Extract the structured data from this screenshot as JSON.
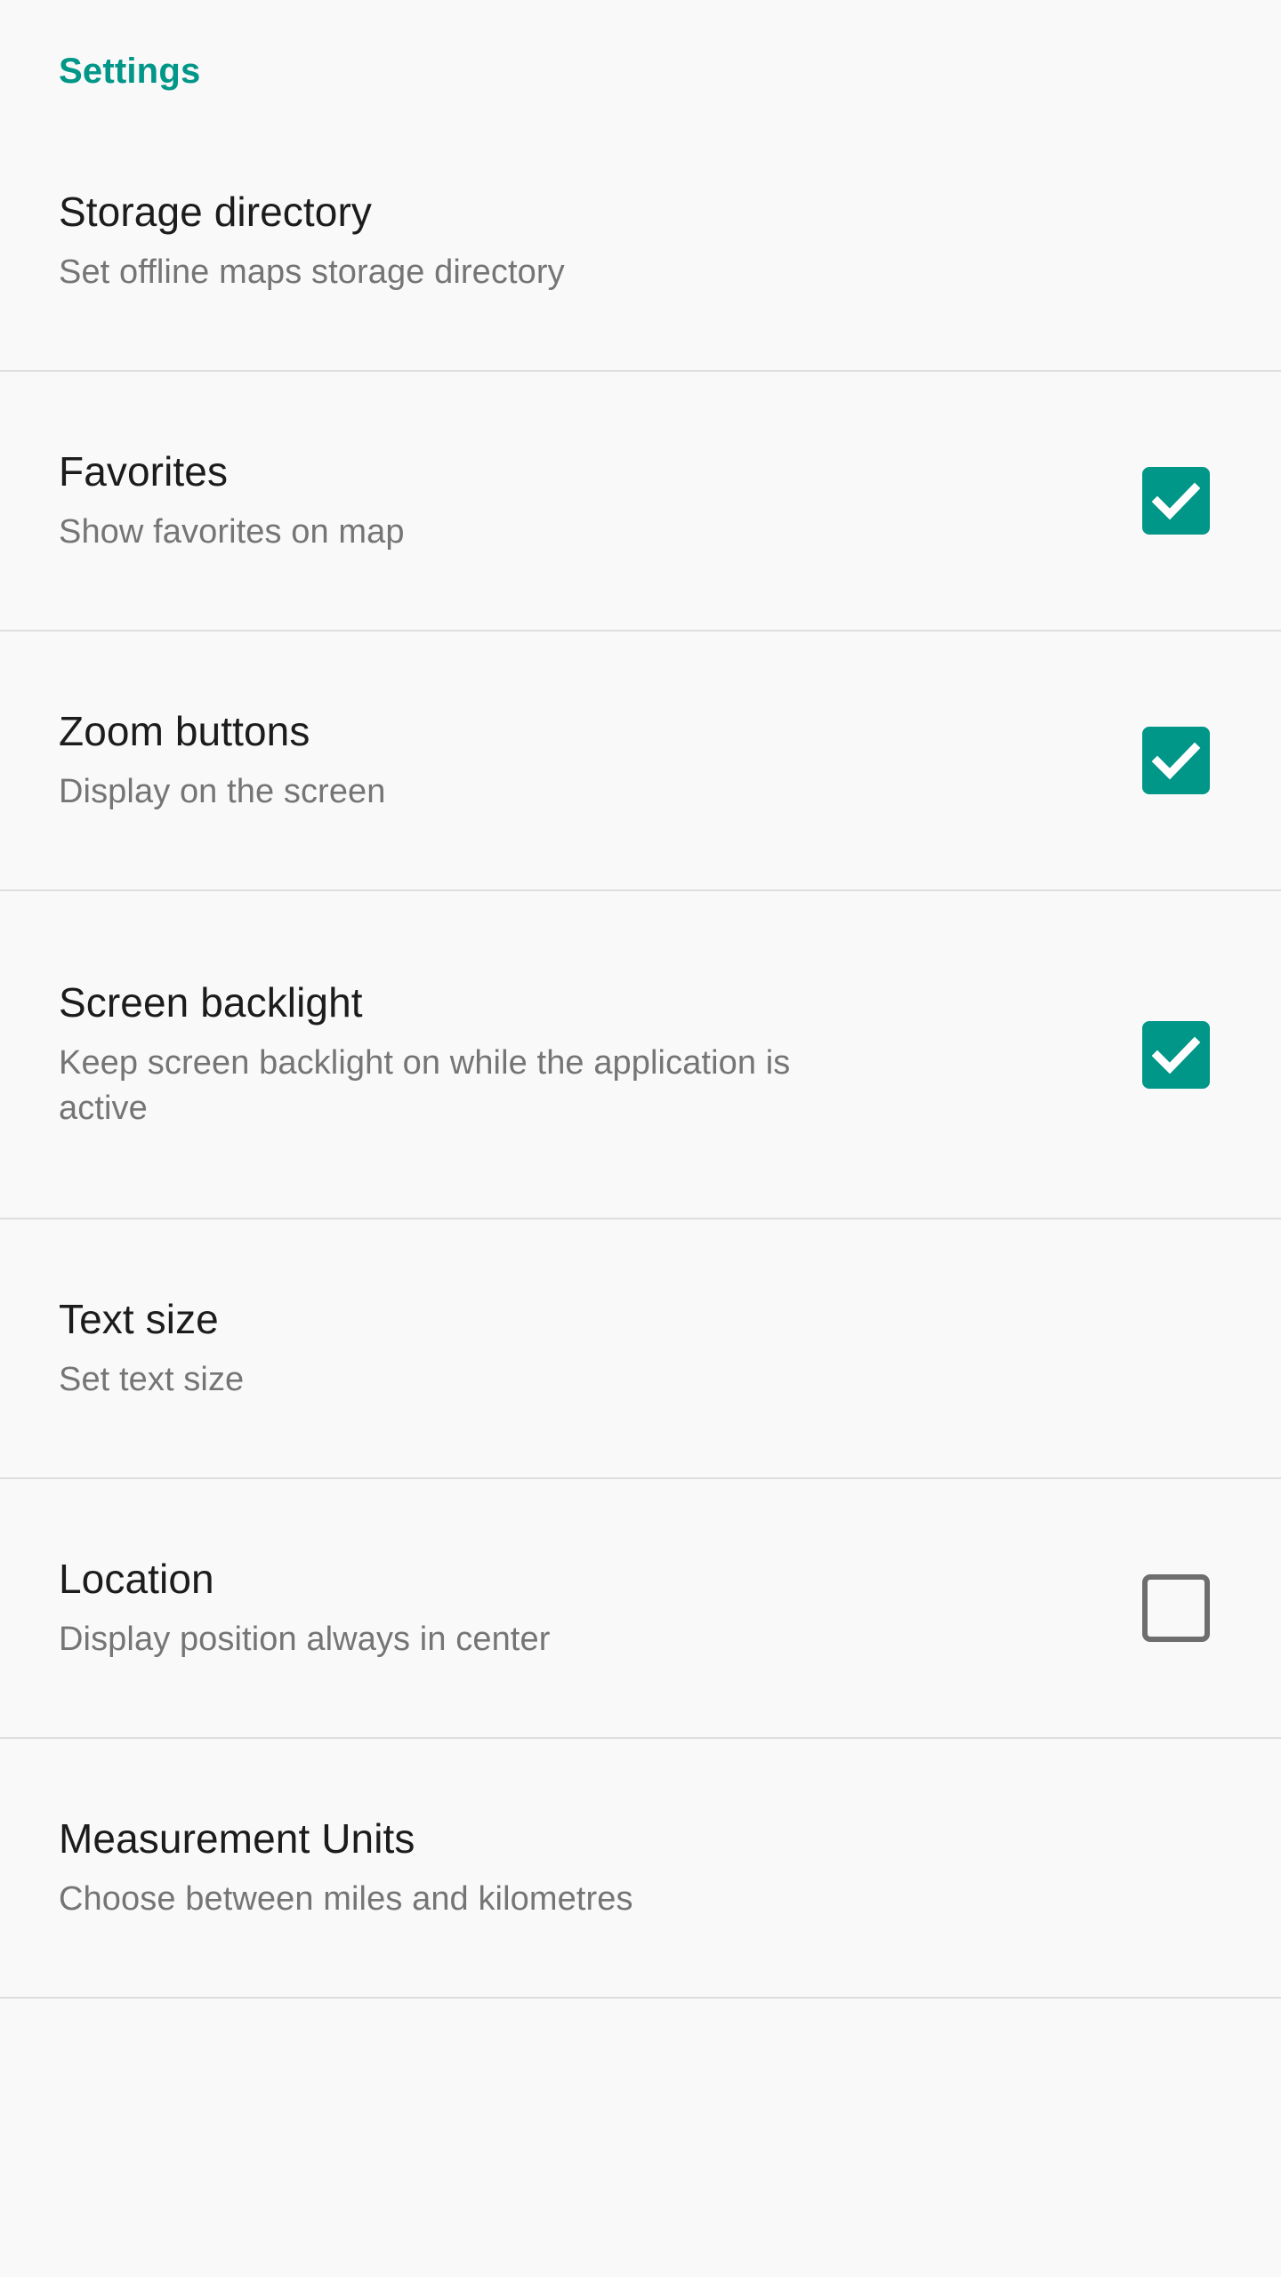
{
  "screen": {
    "background_color": "#f9f9f9",
    "accent_color": "#009688",
    "title_color": "#1c1c1c",
    "summary_color": "#757575",
    "divider_color": "#dedede"
  },
  "section": {
    "header_label": "Settings"
  },
  "preferences": [
    {
      "title": "Storage directory",
      "summary": "Set offline maps storage directory",
      "widget": "none",
      "checked": null
    },
    {
      "title": "Favorites",
      "summary": "Show favorites on map",
      "widget": "checkbox",
      "checked": true
    },
    {
      "title": "Zoom buttons",
      "summary": "Display on the screen",
      "widget": "checkbox",
      "checked": true
    },
    {
      "title": "Screen backlight",
      "summary": "Keep screen backlight on while the application is active",
      "widget": "checkbox",
      "checked": true
    },
    {
      "title": "Text size",
      "summary": "Set text size",
      "widget": "none",
      "checked": null
    },
    {
      "title": "Location",
      "summary": "Display position always in center",
      "widget": "checkbox",
      "checked": false
    },
    {
      "title": "Measurement Units",
      "summary": "Choose between miles and kilometres",
      "widget": "checkbox",
      "checked": null
    }
  ]
}
